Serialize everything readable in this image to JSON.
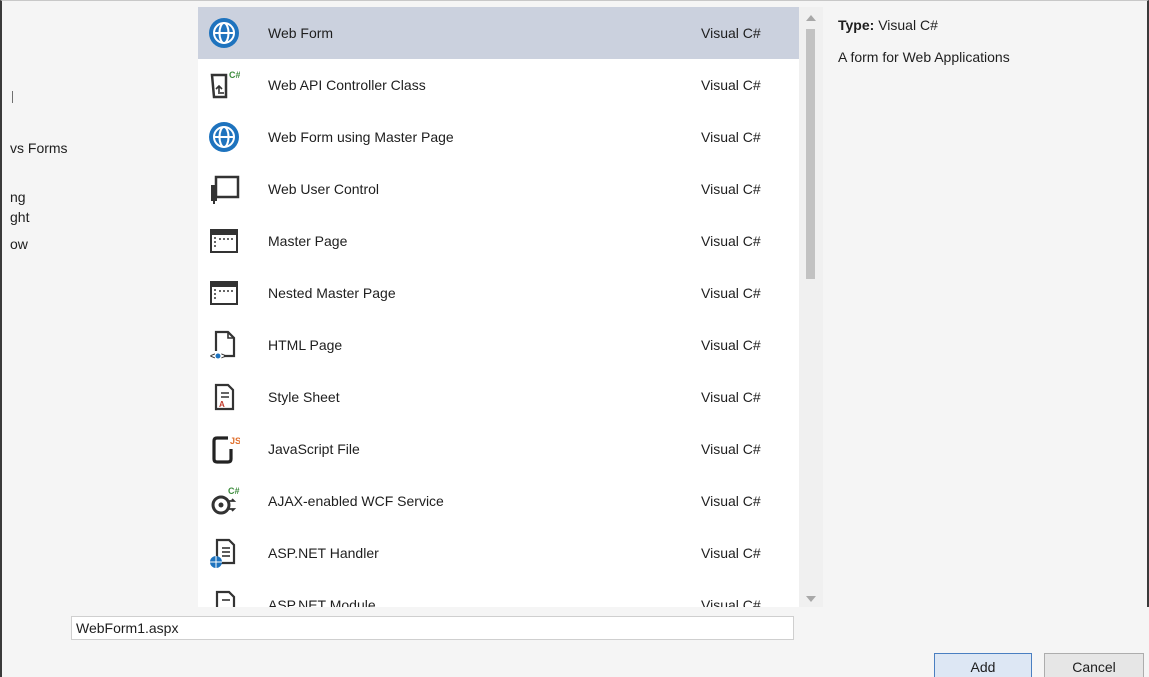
{
  "left_panel": {
    "items": [
      "vs Forms",
      "ng",
      "ght",
      "ow"
    ]
  },
  "templates": [
    {
      "name": "Web Form",
      "lang": "Visual C#",
      "icon": "globe-icon",
      "selected": true
    },
    {
      "name": "Web API Controller Class",
      "lang": "Visual C#",
      "icon": "api-controller-icon",
      "selected": false
    },
    {
      "name": "Web Form using Master Page",
      "lang": "Visual C#",
      "icon": "globe-icon",
      "selected": false
    },
    {
      "name": "Web User Control",
      "lang": "Visual C#",
      "icon": "user-control-icon",
      "selected": false
    },
    {
      "name": "Master Page",
      "lang": "Visual C#",
      "icon": "master-page-icon",
      "selected": false
    },
    {
      "name": "Nested Master Page",
      "lang": "Visual C#",
      "icon": "master-page-icon",
      "selected": false
    },
    {
      "name": "HTML Page",
      "lang": "Visual C#",
      "icon": "html-page-icon",
      "selected": false
    },
    {
      "name": "Style Sheet",
      "lang": "Visual C#",
      "icon": "style-sheet-icon",
      "selected": false
    },
    {
      "name": "JavaScript File",
      "lang": "Visual C#",
      "icon": "javascript-file-icon",
      "selected": false
    },
    {
      "name": "AJAX-enabled WCF Service",
      "lang": "Visual C#",
      "icon": "wcf-service-icon",
      "selected": false
    },
    {
      "name": "ASP.NET Handler",
      "lang": "Visual C#",
      "icon": "handler-icon",
      "selected": false
    },
    {
      "name": "ASP.NET Module",
      "lang": "Visual C#",
      "icon": "module-icon",
      "selected": false
    }
  ],
  "details": {
    "type_label": "Type:",
    "type_value": "Visual C#",
    "description": "A form for Web Applications"
  },
  "name_field": {
    "value": "WebForm1.aspx"
  },
  "buttons": {
    "add": "Add",
    "cancel": "Cancel"
  },
  "colors": {
    "selected_row": "#cbd1de",
    "icon_blue": "#1e73be",
    "badge_green": "#3c8c3c",
    "js_orange": "#e0702e"
  }
}
